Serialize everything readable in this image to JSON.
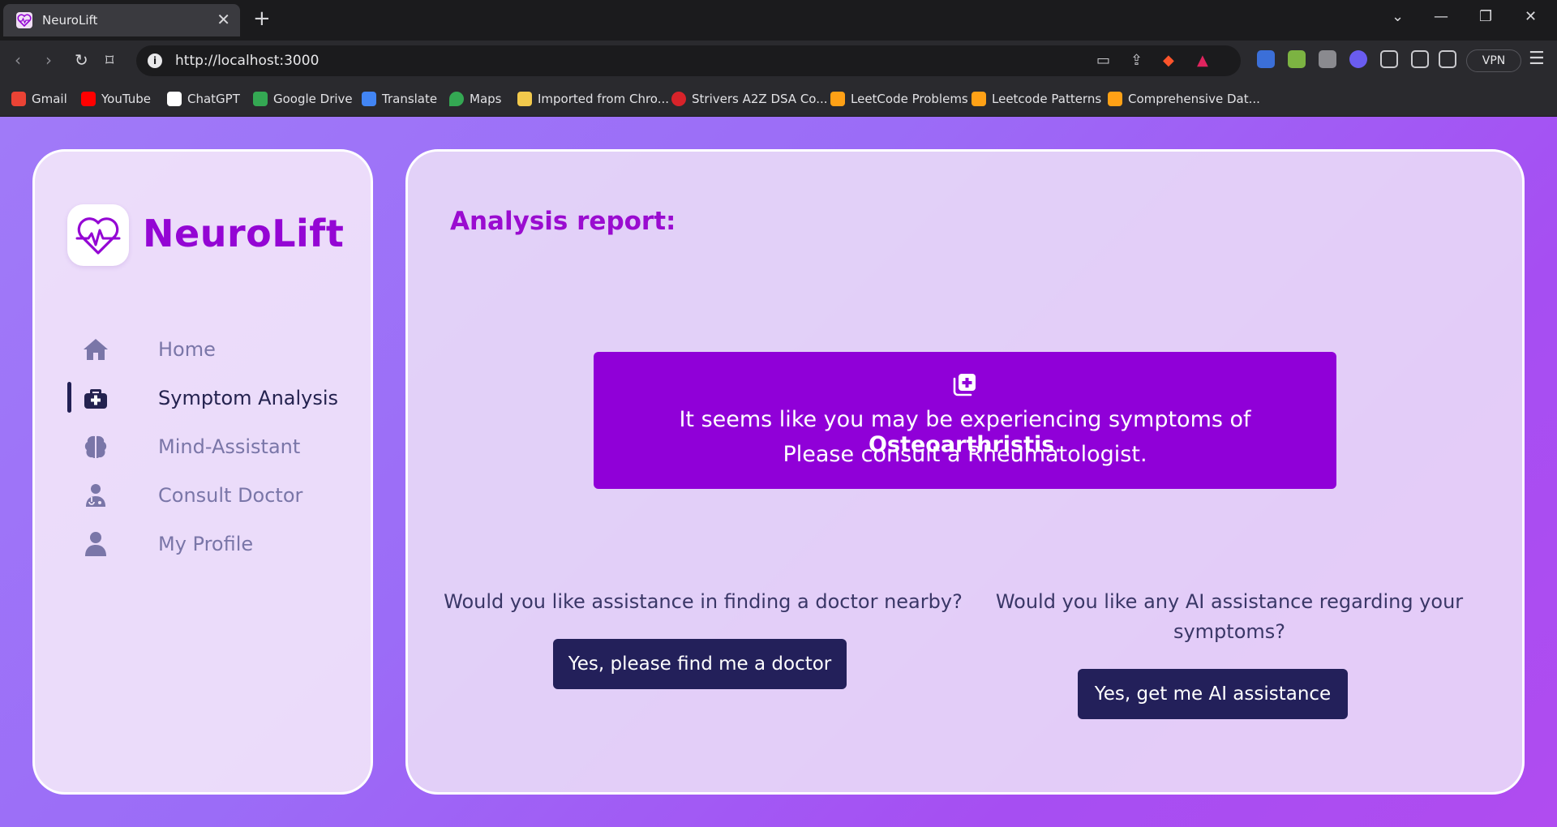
{
  "browser": {
    "tab_title": "NeuroLift",
    "url": "http://localhost:3000",
    "vpn_label": "VPN",
    "bookmarks": [
      {
        "label": "Gmail",
        "icon": "gmail-icon",
        "color": "#ea4335"
      },
      {
        "label": "YouTube",
        "icon": "youtube-icon",
        "color": "#ff0000"
      },
      {
        "label": "ChatGPT",
        "icon": "chatgpt-icon",
        "color": "#ffffff"
      },
      {
        "label": "Google Drive",
        "icon": "drive-icon",
        "color": "#34a853"
      },
      {
        "label": "Translate",
        "icon": "translate-icon",
        "color": "#4285f4"
      },
      {
        "label": "Maps",
        "icon": "maps-icon",
        "color": "#34a853"
      },
      {
        "label": "Imported from Chro...",
        "icon": "folder-icon",
        "color": "#f2c94c"
      },
      {
        "label": "Strivers A2Z DSA Co...",
        "icon": "striver-icon",
        "color": "#d8232a"
      },
      {
        "label": "LeetCode Problems",
        "icon": "leetcode-icon",
        "color": "#ffa116"
      },
      {
        "label": "Leetcode Patterns",
        "icon": "leetcode-patterns-icon",
        "color": "#ffa116"
      },
      {
        "label": "Comprehensive Dat...",
        "icon": "leetcode-icon",
        "color": "#ffa116"
      }
    ]
  },
  "app": {
    "brand": "NeuroLift",
    "brand_color": "#9406d4",
    "sidebar": {
      "items": [
        {
          "label": "Home",
          "icon": "home-icon",
          "active": false
        },
        {
          "label": "Symptom Analysis",
          "icon": "medkit-icon",
          "active": true
        },
        {
          "label": "Mind-Assistant",
          "icon": "brain-icon",
          "active": false
        },
        {
          "label": "Consult Doctor",
          "icon": "doctor-icon",
          "active": false
        },
        {
          "label": "My Profile",
          "icon": "user-icon",
          "active": false
        }
      ]
    },
    "main": {
      "title": "Analysis report:",
      "result": {
        "prefix": "It seems like you may be experiencing symptoms of ",
        "condition": "Osteoarthristis",
        "suffix": ".",
        "advice": "Please consult a Rheumatologist.",
        "icon": "medical-plus-icon",
        "color": "#9000d8"
      },
      "doctor_prompt": {
        "question": "Would you like assistance in finding a doctor nearby?",
        "button_label": "Yes, please find me a doctor"
      },
      "ai_prompt": {
        "question_line1": "Would you like any AI assistance regarding your",
        "question_line2": "symptoms?",
        "button_label": "Yes, get me AI assistance"
      },
      "button_color": "#23205a"
    }
  }
}
